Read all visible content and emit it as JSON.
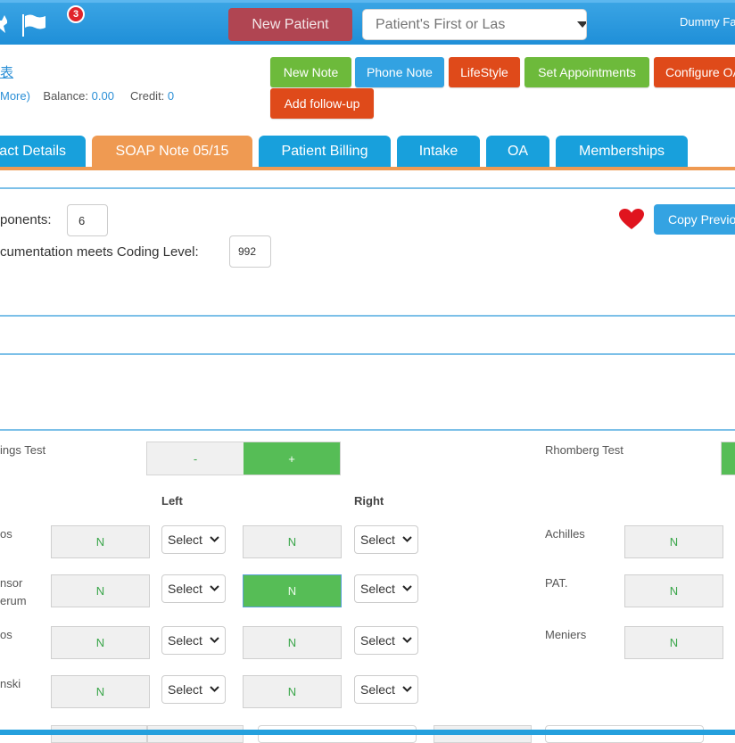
{
  "topbar": {
    "notification_count": "3",
    "new_patient_label": "New Patient",
    "search_placeholder": "Patient's First or Las",
    "user_name": "Dummy Fa",
    "icons": [
      "star-icon",
      "flag-icon",
      "chevron-down-icon",
      "search-icon"
    ]
  },
  "patient": {
    "name": "表",
    "more_link": "More)",
    "balance_label": "Balance:",
    "balance_value": "0.00",
    "credit_label": "Credit:",
    "credit_value": "0"
  },
  "actions": {
    "new_note": "New Note",
    "phone_note": "Phone Note",
    "lifestyle": "LifeStyle",
    "set_appointments": "Set Appointments",
    "configure_oa": "Configure OA",
    "add_follow_up": "Add follow-up"
  },
  "tabs": [
    {
      "label": "act Details",
      "active": false
    },
    {
      "label": "SOAP Note 05/15",
      "active": true
    },
    {
      "label": "Patient Billing",
      "active": false
    },
    {
      "label": "Intake",
      "active": false
    },
    {
      "label": "OA",
      "active": false
    },
    {
      "label": "Memberships",
      "active": false
    }
  ],
  "coding": {
    "components_label": "ponents:",
    "components_value": "6",
    "coding_level_label": "cumentation meets Coding Level:",
    "coding_level_value": "992",
    "copy_previous_label": "Copy Previo"
  },
  "exam": {
    "hastings_label": "ings Test",
    "toggle_minus": "-",
    "toggle_plus": "+",
    "toggle_selected": "+",
    "rhomberg_label": "Rhomberg Test",
    "left_header": "Left",
    "right_header": "Right",
    "select_placeholder": "Select",
    "rows": [
      {
        "label": "os",
        "left": "N",
        "right": "N",
        "right_active": false
      },
      {
        "label": "nsor\nerum",
        "left": "N",
        "right": "N",
        "right_active": true
      },
      {
        "label": "os",
        "left": "N",
        "right": "N",
        "right_active": false
      },
      {
        "label": "nski",
        "left": "N",
        "right": "N",
        "right_active": false
      }
    ],
    "right_rows": [
      {
        "label": "Achilles",
        "value": "N"
      },
      {
        "label": "PAT.",
        "value": "N"
      },
      {
        "label": "Meniers",
        "value": "N"
      }
    ]
  },
  "colors": {
    "topbar_blue": "#2892dc",
    "new_patient": "#b04552",
    "green": "#6dba3b",
    "blue": "#32a2e2",
    "red": "#df4a1a",
    "tab_blue": "#18a0dc",
    "tab_active": "#ef9a52",
    "toggle_green": "#56bd56",
    "heart": "#e0141e"
  }
}
